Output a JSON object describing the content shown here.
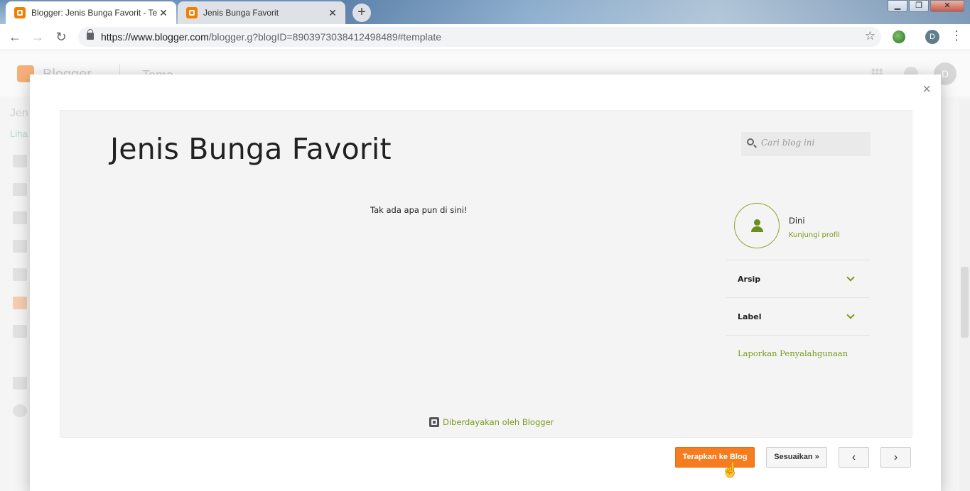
{
  "browser": {
    "tabs": [
      {
        "title": "Blogger: Jenis Bunga Favorit - Te",
        "close": "✕"
      },
      {
        "title": "Jenis Bunga Favorit",
        "close": "✕"
      }
    ],
    "new_tab": "+",
    "url_host": "https://www.blogger.com",
    "url_path": "/blogger.g?blogID=8903973038412498489#template",
    "profile_initial": "D",
    "window_buttons": [
      "▁",
      "❐",
      "✕"
    ]
  },
  "background_page": {
    "brand": "Blogger",
    "section": "Tema",
    "side_text_1": "Jen",
    "side_text_2": "Liha",
    "avatar_initial": "D"
  },
  "modal": {
    "close": "×",
    "preview": {
      "blog_title": "Jenis Bunga Favorit",
      "search_placeholder": "Cari blog ini",
      "empty_message": "Tak ada apa pun di sini!",
      "profile_name": "Dini",
      "profile_link": "Kunjungi profil",
      "sidebar_items": [
        "Arsip",
        "Label"
      ],
      "report_link": "Laporkan Penyalahgunaan",
      "powered_by": "Diberdayakan oleh Blogger"
    },
    "buttons": {
      "apply": "Terapkan ke Blog",
      "customize": "Sesuaikan »",
      "prev": "‹",
      "next": "›"
    }
  },
  "colors": {
    "accent_orange": "#f57d20",
    "link_green": "#7a9a1a"
  }
}
